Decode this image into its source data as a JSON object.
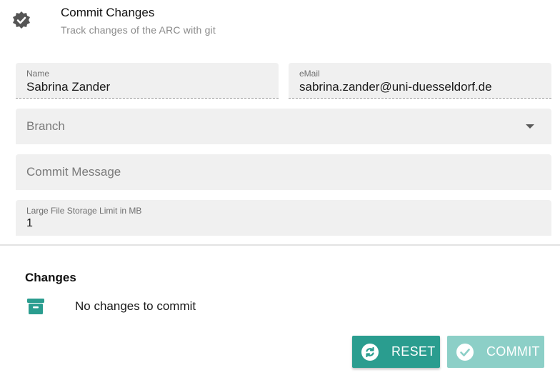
{
  "header": {
    "title": "Commit Changes",
    "subtitle": "Track changes of the ARC with git",
    "icon": "verified-badge-icon"
  },
  "form": {
    "name": {
      "label": "Name",
      "value": "Sabrina Zander"
    },
    "email": {
      "label": "eMail",
      "value": "sabrina.zander@uni-duesseldorf.de"
    },
    "branch": {
      "placeholder": "Branch"
    },
    "commit_message": {
      "placeholder": "Commit Message"
    },
    "lfs_limit": {
      "label": "Large File Storage Limit in MB",
      "value": "1"
    }
  },
  "changes": {
    "heading": "Changes",
    "empty_text": "No changes to commit",
    "icon": "archive-icon"
  },
  "actions": {
    "reset_label": "RESET",
    "commit_label": "COMMIT",
    "reset_icon": "sync-icon",
    "commit_icon": "check-circle-icon"
  },
  "colors": {
    "accent": "#2a9d8f",
    "accent_disabled": "#8ccfc7",
    "field_bg": "#f0f0f0"
  }
}
